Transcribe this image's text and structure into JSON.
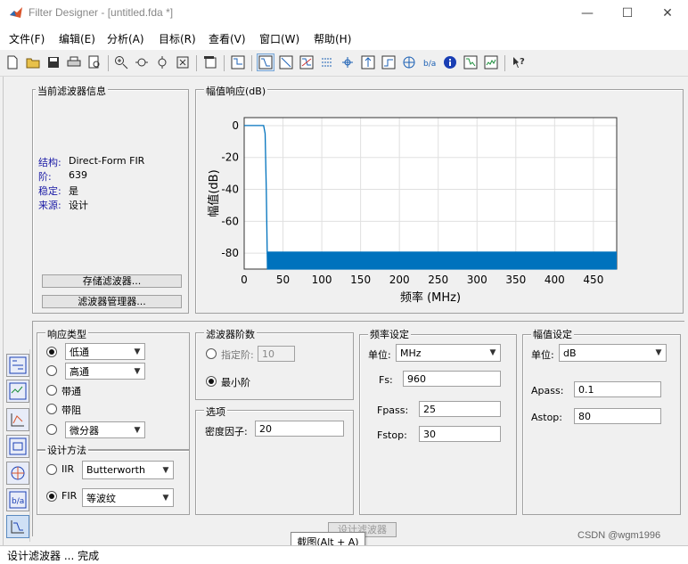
{
  "window": {
    "title": "Filter Designer -  [untitled.fda *]",
    "minimize": "—",
    "maximize": "☐",
    "close": "✕"
  },
  "menu": [
    "文件(F)",
    "编辑(E)",
    "分析(A)",
    "目标(R)",
    "查看(V)",
    "窗口(W)",
    "帮助(H)"
  ],
  "filter_info": {
    "title": "当前滤波器信息",
    "structure_label": "结构:",
    "structure_value": "Direct-Form FIR",
    "order_label": "阶:",
    "order_value": "639",
    "stable_label": "稳定:",
    "stable_value": "是",
    "source_label": "来源:",
    "source_value": "设计",
    "store_button": "存储滤波器...",
    "manager_button": "滤波器管理器..."
  },
  "magnitude_panel": {
    "title": "幅值响应(dB)"
  },
  "chart_data": {
    "type": "line",
    "title": "",
    "xlabel": "频率 (MHz)",
    "ylabel": "幅值(dB)",
    "xlim": [
      0,
      480
    ],
    "ylim": [
      -90,
      5
    ],
    "xticks": [
      "0",
      "50",
      "100",
      "150",
      "200",
      "250",
      "300",
      "350",
      "400",
      "450"
    ],
    "xtick_values": [
      0,
      50,
      100,
      150,
      200,
      250,
      300,
      350,
      400,
      450
    ],
    "yticks": [
      "0",
      "-20",
      "-40",
      "-60",
      "-80"
    ],
    "ytick_values": [
      0,
      -20,
      -40,
      -60,
      -80
    ],
    "grid": true,
    "line_color": "#0072bd",
    "series": [
      {
        "x": [
          0,
          25,
          27,
          28.5,
          30,
          480
        ],
        "y": [
          0,
          0,
          -5,
          -40,
          -90,
          -90
        ]
      }
    ],
    "stopband": {
      "x_start": 30,
      "x_end": 480,
      "y_top": -79,
      "y_bottom": -90
    }
  },
  "response_type": {
    "title": "响应类型",
    "lowpass": "低通",
    "highpass": "高通",
    "bandpass": "带通",
    "bandstop": "带阻",
    "differentiator": "微分器"
  },
  "design_method": {
    "title": "设计方法",
    "iir_label": "IIR",
    "iir_value": "Butterworth",
    "fir_label": "FIR",
    "fir_value": "等波纹"
  },
  "filter_order": {
    "title": "滤波器阶数",
    "specify_label": "指定阶:",
    "specify_value": "10",
    "minimum_label": "最小阶"
  },
  "options": {
    "title": "选项",
    "density_label": "密度因子:",
    "density_value": "20"
  },
  "freq_spec": {
    "title": "频率设定",
    "unit_label": "单位:",
    "unit_value": "MHz",
    "fs_label": "Fs:",
    "fs_value": "960",
    "fpass_label": "Fpass:",
    "fpass_value": "25",
    "fstop_label": "Fstop:",
    "fstop_value": "30"
  },
  "mag_spec": {
    "title": "幅值设定",
    "unit_label": "单位:",
    "unit_value": "dB",
    "apass_label": "Apass:",
    "apass_value": "0.1",
    "astop_label": "Astop:",
    "astop_value": "80"
  },
  "design_button": "设计滤波器",
  "tooltip": "截图(Alt + A)",
  "status": "设计滤波器 ... 完成",
  "watermark": "CSDN @wgm1996"
}
